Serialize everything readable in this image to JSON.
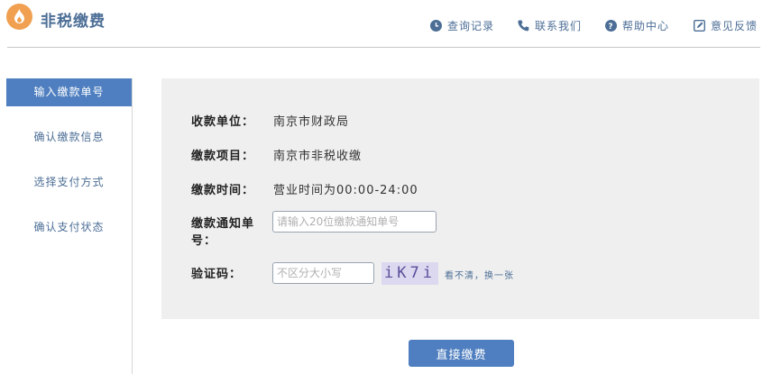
{
  "header": {
    "title": "非税缴费",
    "links": [
      {
        "label": "查询记录",
        "icon": "clock-icon"
      },
      {
        "label": "联系我们",
        "icon": "phone-icon"
      },
      {
        "label": "帮助中心",
        "icon": "help-icon"
      },
      {
        "label": "意见反馈",
        "icon": "edit-icon"
      }
    ]
  },
  "sidebar": {
    "items": [
      {
        "label": "输入缴款单号",
        "active": true
      },
      {
        "label": "确认缴款信息",
        "active": false
      },
      {
        "label": "选择支付方式",
        "active": false
      },
      {
        "label": "确认支付状态",
        "active": false
      }
    ]
  },
  "form": {
    "payee_label": "收款单位：",
    "payee_value": "南京市财政局",
    "item_label": "缴款项目：",
    "item_value": "南京市非税收缴",
    "hours_label": "缴款时间：",
    "hours_value": "营业时间为00:00-24:00",
    "notice_label_line1": "缴款通知单",
    "notice_label_line2": "号：",
    "notice_placeholder": "请输入20位缴款通知单号",
    "captcha_label": "验证码：",
    "captcha_placeholder": "不区分大小写",
    "captcha_text": "iK7i",
    "captcha_refresh": "看不清，换一张"
  },
  "actions": {
    "submit_label": "直接缴费"
  },
  "colors": {
    "accent": "#4f7fc0",
    "link": "#4c6e96",
    "logo": "#f0a050",
    "panel_bg": "#efefef"
  }
}
